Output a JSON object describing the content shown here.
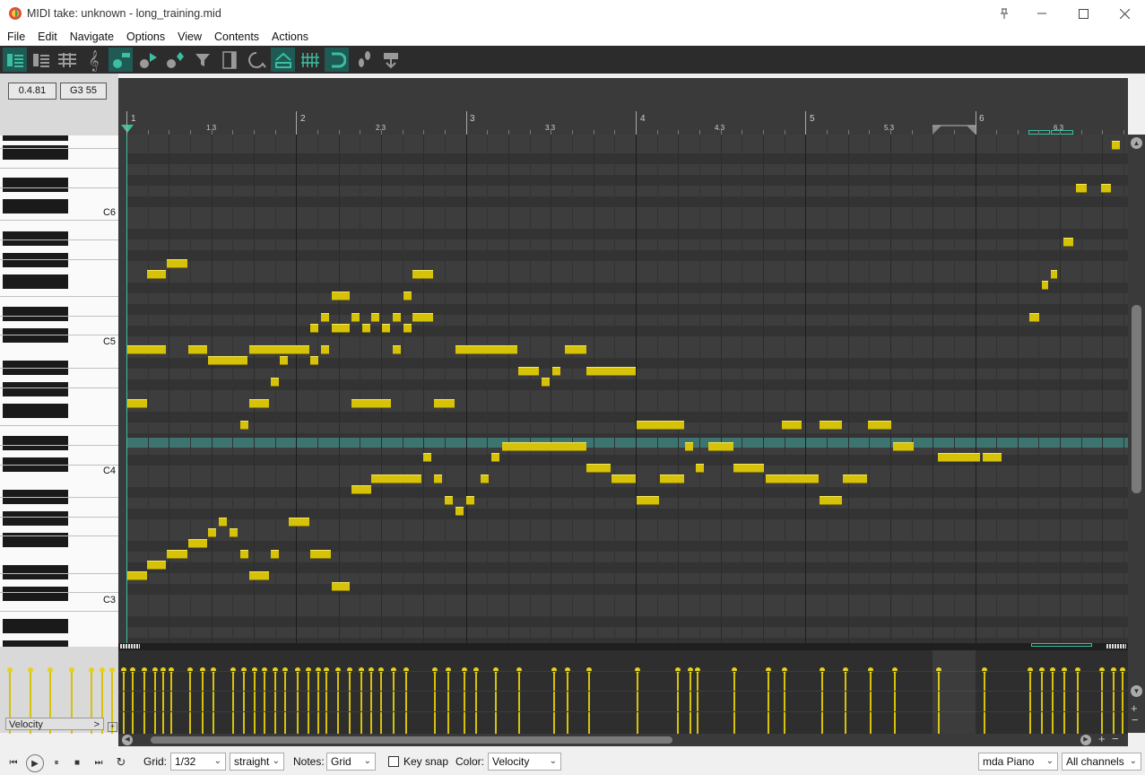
{
  "window": {
    "title": "MIDI take: unknown - long_training.mid",
    "pin": "pin-icon",
    "minimize": "minimize-icon",
    "maximize": "maximize-icon",
    "close": "close-icon"
  },
  "menu": [
    "File",
    "Edit",
    "Navigate",
    "Options",
    "View",
    "Contents",
    "Actions"
  ],
  "position": {
    "time": "0.4.81",
    "pitch": "G3  55"
  },
  "ruler": {
    "bars": [
      "1",
      "2",
      "3",
      "4",
      "5",
      "6"
    ],
    "beats": [
      "1.3",
      "2.3",
      "3.3",
      "4.3",
      "5.3",
      "6.3"
    ]
  },
  "keyboard": {
    "labels": [
      "C6",
      "C5",
      "C4",
      "C3"
    ]
  },
  "cc_lane": {
    "label": "Velocity",
    "arrow": ">"
  },
  "status": {
    "grid_label": "Grid:",
    "grid_value": "1/32",
    "grid_type": "straight",
    "notes_label": "Notes:",
    "notes_value": "Grid",
    "key_snap": "Key snap",
    "color_label": "Color:",
    "color_value": "Velocity",
    "instrument": "mda Piano",
    "channels": "All channels"
  },
  "colors": {
    "note": "#d7c20a",
    "highlight_row": "#3e7470",
    "accent": "#3bbfa0"
  },
  "notes": [
    [
      0,
      17,
      5
    ],
    [
      0,
      22,
      10
    ],
    [
      0,
      33,
      15
    ],
    [
      0,
      40,
      15
    ],
    [
      1,
      20,
      15
    ],
    [
      1,
      22,
      4
    ],
    [
      1,
      29,
      16
    ],
    [
      1,
      34,
      15
    ],
    [
      2,
      18,
      4
    ],
    [
      2,
      20,
      5
    ],
    [
      2,
      33,
      8
    ],
    [
      2,
      30,
      2
    ],
    [
      2,
      37,
      2
    ],
    [
      3,
      17,
      2
    ],
    [
      3,
      33,
      6
    ],
    [
      3,
      34,
      2
    ],
    [
      3,
      38,
      6
    ],
    [
      3,
      46,
      5
    ],
    [
      4,
      16,
      10
    ],
    [
      4,
      36,
      3
    ],
    [
      4,
      44,
      4
    ],
    [
      5,
      16,
      6
    ],
    [
      5,
      43,
      4
    ],
    [
      6,
      15,
      4
    ],
    [
      6,
      38,
      5
    ],
    [
      6,
      43,
      3
    ],
    [
      7,
      17,
      2
    ],
    [
      7,
      36,
      2
    ],
    [
      7,
      43,
      3
    ],
    [
      7,
      46,
      3
    ],
    [
      8,
      16,
      4
    ],
    [
      8,
      37,
      4
    ],
    [
      8,
      41,
      7
    ],
    [
      8,
      42,
      6
    ],
    [
      8,
      43,
      2
    ],
    [
      9,
      44,
      4
    ],
    [
      9,
      37,
      2
    ],
    [
      10,
      15,
      4
    ],
    [
      10,
      37,
      2
    ],
    [
      11,
      23,
      4
    ],
    [
      11,
      38,
      2
    ],
    [
      11,
      47,
      3
    ],
    [
      12,
      17,
      2
    ],
    [
      12,
      28,
      2
    ],
    [
      12,
      41,
      5
    ],
    [
      12,
      42,
      2
    ],
    [
      12,
      46,
      3
    ],
    [
      13,
      13,
      2
    ],
    [
      13,
      17,
      4
    ],
    [
      13,
      34,
      5
    ],
    [
      13,
      45,
      2
    ],
    [
      14,
      17,
      2
    ],
    [
      14,
      21,
      8
    ],
    [
      14,
      26,
      6
    ],
    [
      14,
      30,
      6
    ],
    [
      14,
      40,
      3
    ],
    [
      15,
      29,
      4
    ],
    [
      15,
      41,
      3
    ],
    [
      16,
      27,
      5
    ],
    [
      16,
      36,
      6
    ],
    [
      16,
      28,
      3
    ],
    [
      17,
      26,
      5
    ],
    [
      17,
      27,
      2
    ],
    [
      18,
      14,
      2
    ],
    [
      18,
      30,
      7
    ],
    [
      18,
      33,
      4
    ],
    [
      18,
      42,
      7
    ]
  ]
}
